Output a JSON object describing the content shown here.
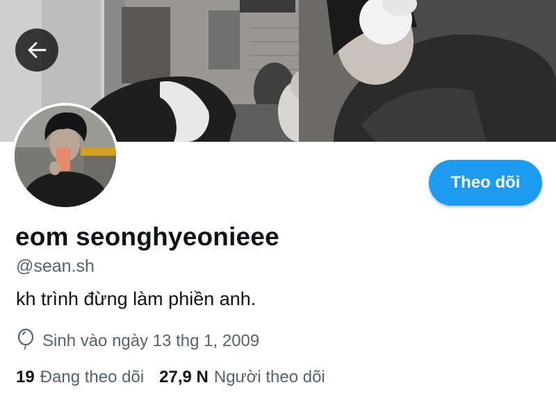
{
  "profile": {
    "display_name": "eom seonghyeonieee",
    "handle": "@sean.sh",
    "bio": "kh trình đừng làm phiền anh.",
    "birth": "Sinh vào ngày 13 thg 1, 2009",
    "following_count": "19",
    "following_label": "Đang theo dõi",
    "followers_count": "27,9 N",
    "followers_label": "Người theo dõi"
  },
  "actions": {
    "follow_label": "Theo dõi"
  },
  "icons": {
    "back": "arrow-left-icon",
    "birth": "balloon-icon"
  },
  "colors": {
    "accent": "#1d9bf0",
    "text_primary": "#0f1419",
    "text_secondary": "#536471"
  }
}
